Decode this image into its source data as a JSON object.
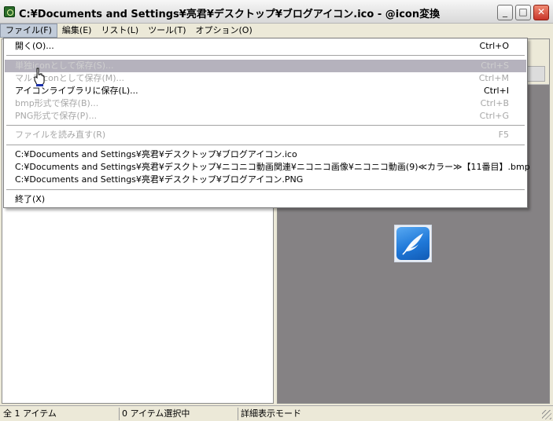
{
  "window": {
    "title": "C:¥Documents and Settings¥亮君¥デスクトップ¥ブログアイコン.ico - @icon変換",
    "min_glyph": "_",
    "max_glyph": "□",
    "close_glyph": "✕"
  },
  "menubar": {
    "items": [
      "ファイル(F)",
      "編集(E)",
      "リスト(L)",
      "ツール(T)",
      "オプション(O)"
    ]
  },
  "file_menu": {
    "open": {
      "label": "開く(O)...",
      "shortcut": "Ctrl+O"
    },
    "save_single": {
      "label": "単独iconとして保存(S)...",
      "shortcut": "Ctrl+S"
    },
    "save_multi": {
      "label": "マルチiconとして保存(M)...",
      "shortcut": "Ctrl+M"
    },
    "save_library": {
      "label": "アイコンライブラリに保存(L)...",
      "shortcut": "Ctrl+I"
    },
    "save_bmp": {
      "label": "bmp形式で保存(B)...",
      "shortcut": "Ctrl+B"
    },
    "save_png": {
      "label": "PNG形式で保存(P)...",
      "shortcut": "Ctrl+G"
    },
    "reload": {
      "label": "ファイルを読み直す(R)",
      "shortcut": "F5"
    },
    "recent": [
      "C:¥Documents and Settings¥亮君¥デスクトップ¥ブログアイコン.ico",
      "C:¥Documents and Settings¥亮君¥デスクトップ¥ニコニコ動画関連¥ニコニコ画像¥ニコニコ動画(9)≪カラー≫【11番目】.bmp",
      "C:¥Documents and Settings¥亮君¥デスクトップ¥ブログアイコン.PNG"
    ],
    "exit": {
      "label": "終了(X)"
    }
  },
  "statusbar": {
    "total_items": "全 1 アイテム",
    "selected_items": "0 アイテム選択中",
    "view_mode": "詳細表示モード"
  },
  "icons": {
    "app": "app-icon",
    "preview": "quill-feather-icon",
    "cursor": "hand-pointer-icon"
  },
  "colors": {
    "menu_highlight": "#b5b2bd",
    "preview_background": "#858284",
    "disabled_text": "#a7a7a7"
  }
}
